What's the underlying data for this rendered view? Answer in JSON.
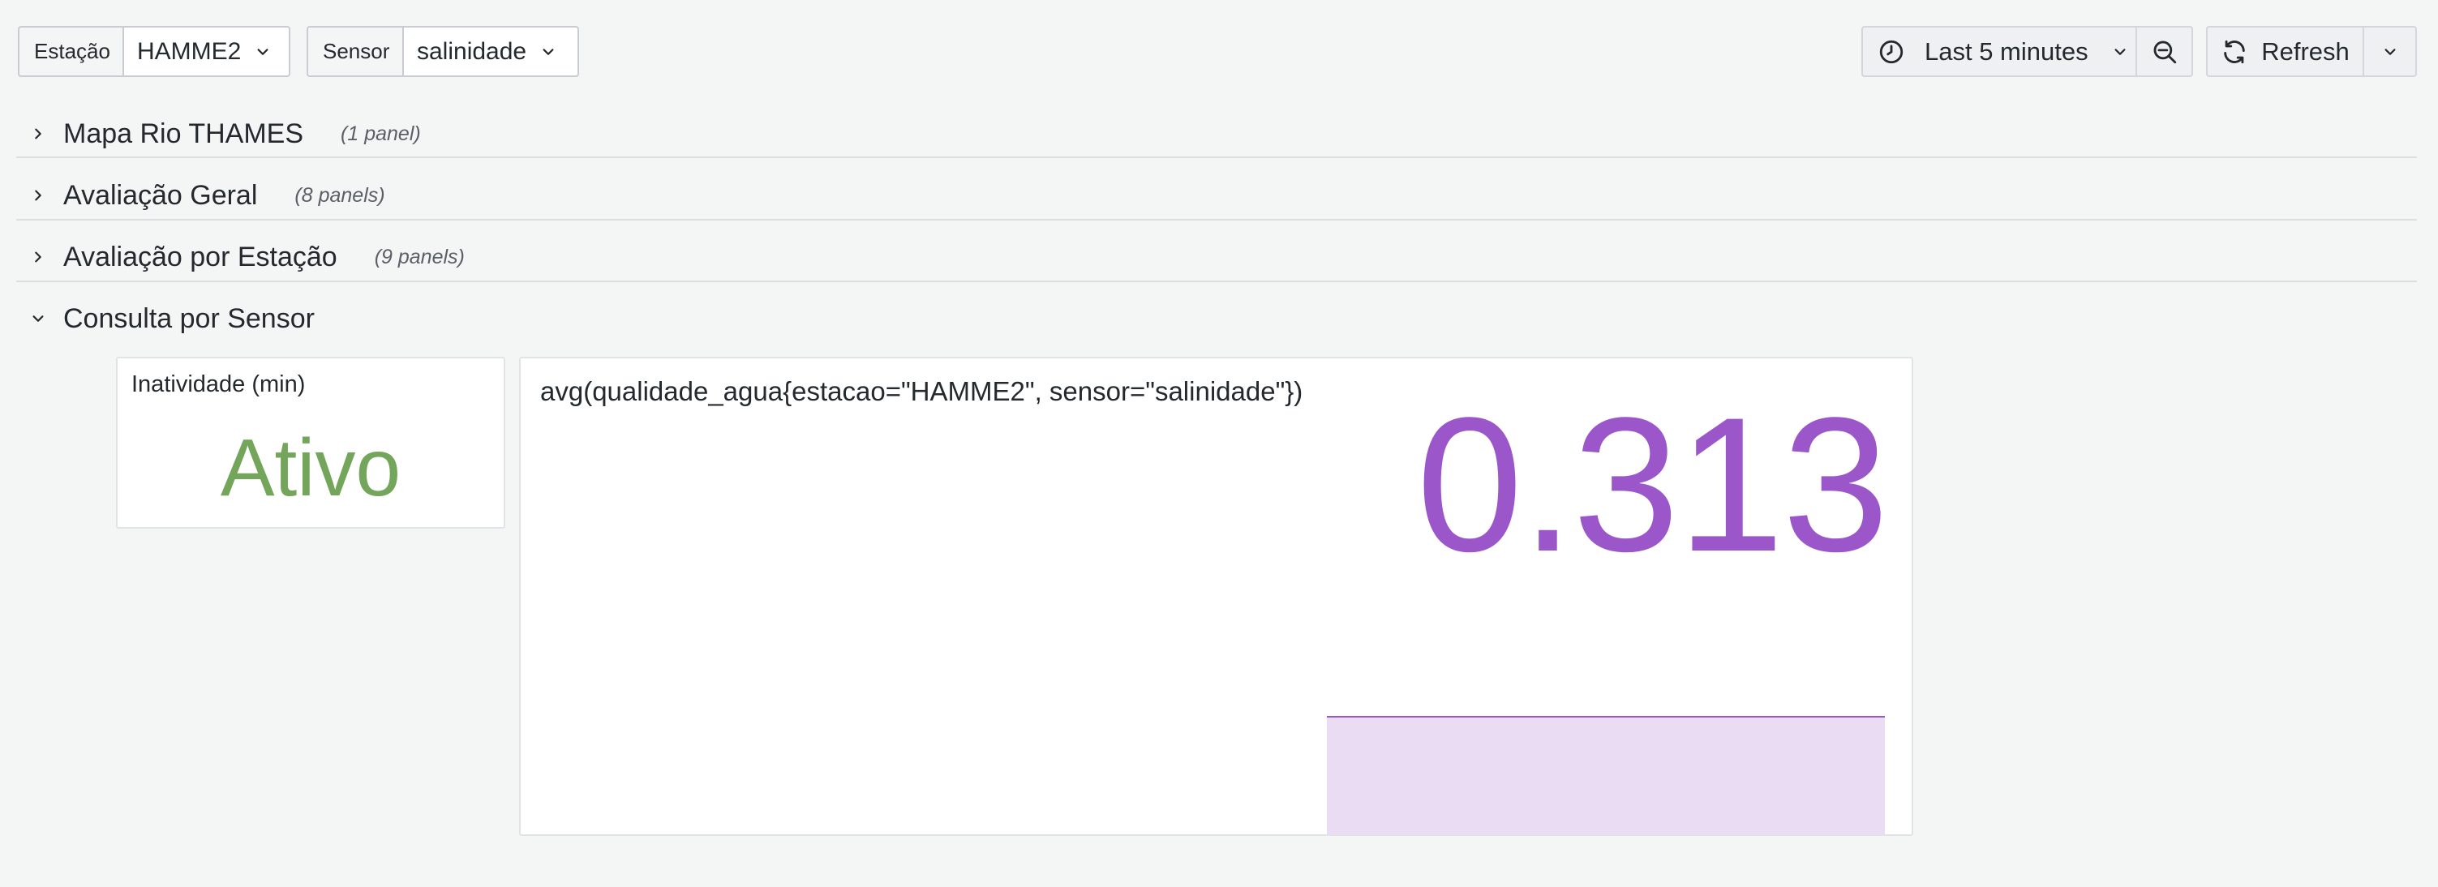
{
  "variables": {
    "station": {
      "label": "Estação",
      "value": "HAMME2"
    },
    "sensor": {
      "label": "Sensor",
      "value": "salinidade"
    }
  },
  "toolbar": {
    "time_range": "Last 5 minutes",
    "refresh_label": "Refresh"
  },
  "rows": [
    {
      "title": "Mapa Rio THAMES",
      "count": "(1 panel)",
      "collapsed": true
    },
    {
      "title": "Avaliação Geral",
      "count": "(8 panels)",
      "collapsed": true
    },
    {
      "title": "Avaliação por Estação",
      "count": "(9 panels)",
      "collapsed": true
    },
    {
      "title": "Consulta por Sensor",
      "count": "",
      "collapsed": false
    }
  ],
  "panels": {
    "inactivity": {
      "title": "Inatividade (min)",
      "value": "Ativo",
      "color": "#73a55a"
    },
    "sensor_stat": {
      "query": "avg(qualidade_agua{estacao=\"HAMME2\", sensor=\"salinidade\"})",
      "value": "0.313",
      "color": "#9b57c9",
      "sparkline_fill": "#eadcf3"
    }
  },
  "colors": {
    "background": "#f4f5f5",
    "accent_green": "#73a55a",
    "accent_purple": "#9b57c9"
  }
}
